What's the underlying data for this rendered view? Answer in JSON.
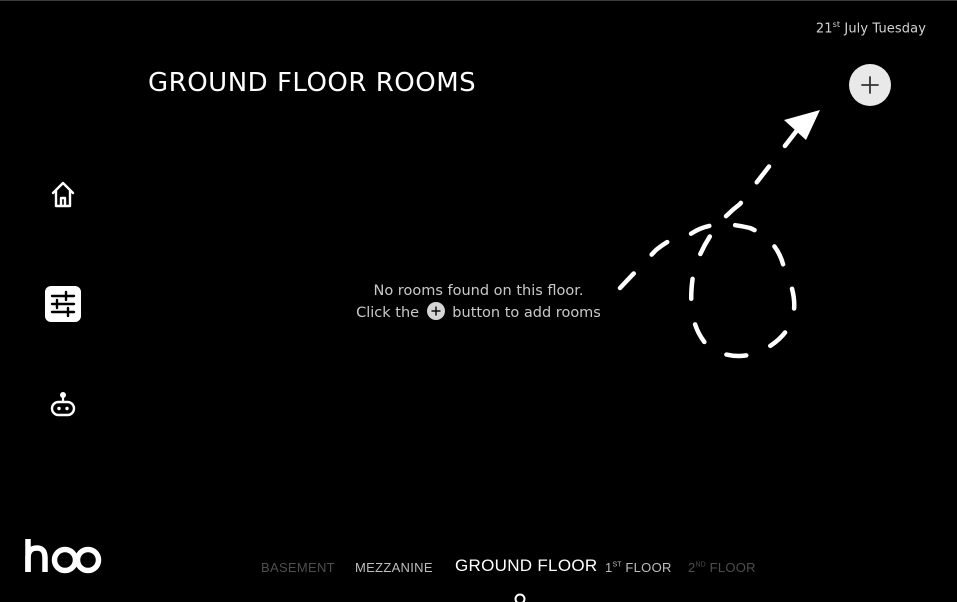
{
  "header": {
    "date_day": "21",
    "date_suffix": "st",
    "date_rest": "July Tuesday",
    "title": "GROUND FLOOR ROOMS"
  },
  "sidebar": {
    "items": [
      {
        "icon": "home-icon"
      },
      {
        "icon": "sliders-icon"
      },
      {
        "icon": "robot-icon"
      }
    ]
  },
  "empty_state": {
    "line1": "No rooms found on this floor.",
    "line2_before": "Click the",
    "line2_after": "button to add rooms"
  },
  "brand": {
    "logo_text": "hoo"
  },
  "floors": {
    "basement": "BASEMENT",
    "mezzanine": "MEZZANINE",
    "ground": "GROUND FLOOR",
    "first_num": "1",
    "first_suffix": "ST",
    "first_label": "FLOOR",
    "second_num": "2",
    "second_suffix": "ND",
    "second_label": "FLOOR",
    "selected": "GROUND FLOOR"
  },
  "colors": {
    "background": "#000000",
    "text": "#ffffff",
    "add_button": "#e9e9e9",
    "inactive_tab": "#4e4e4e"
  }
}
